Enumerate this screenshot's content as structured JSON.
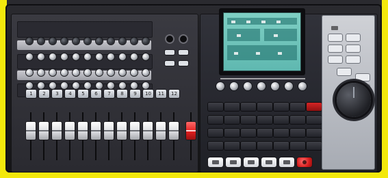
{
  "image": {
    "track_buttons": [
      "1",
      "2",
      "3",
      "4",
      "5",
      "6",
      "7",
      "8",
      "9",
      "10",
      "11",
      "12"
    ]
  },
  "colors": {
    "background": "#f3e80c",
    "chassis": "#1c1c20",
    "lcd": "#6fc3bb",
    "record": "#d41b1b"
  },
  "icons": {
    "fader": "fader-icon",
    "knob": "knob-icon",
    "jog_dial": "jog-dial-icon",
    "screen": "lcd-screen-icon",
    "transport": "transport-button-icon"
  }
}
